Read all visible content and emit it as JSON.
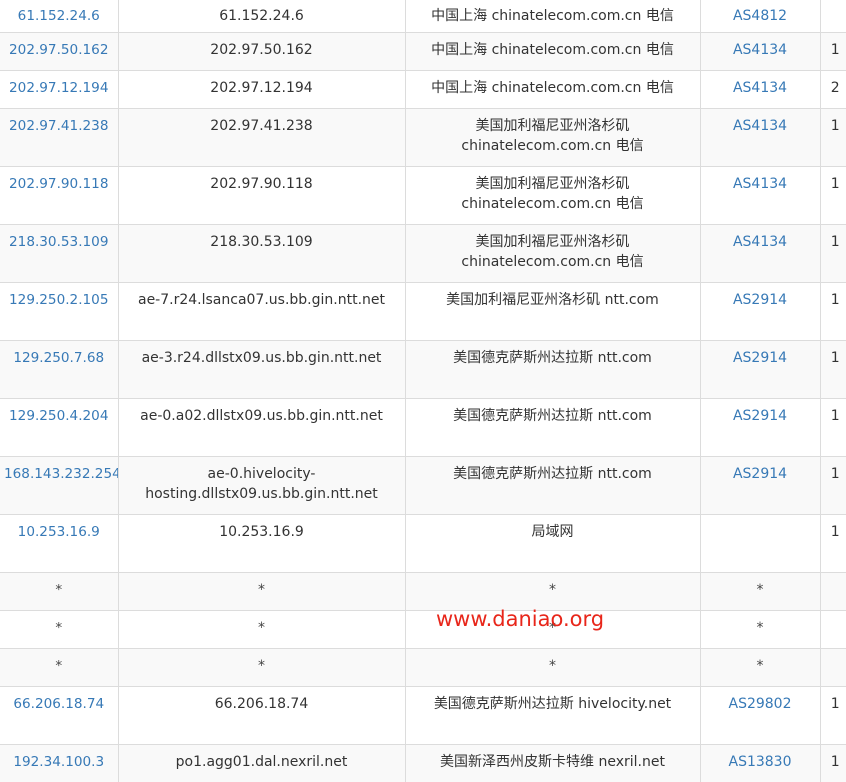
{
  "watermark": "www.daniao.org",
  "rows": [
    {
      "ip": "61.152.24.6",
      "host": "61.152.24.6",
      "location": "中国上海 chinatelecom.com.cn 电信",
      "asn": "AS4812",
      "extra": ""
    },
    {
      "ip": "202.97.50.162",
      "host": "202.97.50.162",
      "location": "中国上海 chinatelecom.com.cn 电信",
      "asn": "AS4134",
      "extra": "1"
    },
    {
      "ip": "202.97.12.194",
      "host": "202.97.12.194",
      "location": "中国上海 chinatelecom.com.cn 电信",
      "asn": "AS4134",
      "extra": "2"
    },
    {
      "ip": "202.97.41.238",
      "host": "202.97.41.238",
      "location": "美国加利福尼亚州洛杉矶 chinatelecom.com.cn 电信",
      "asn": "AS4134",
      "extra": "1"
    },
    {
      "ip": "202.97.90.118",
      "host": "202.97.90.118",
      "location": "美国加利福尼亚州洛杉矶 chinatelecom.com.cn 电信",
      "asn": "AS4134",
      "extra": "1"
    },
    {
      "ip": "218.30.53.109",
      "host": "218.30.53.109",
      "location": "美国加利福尼亚州洛杉矶 chinatelecom.com.cn 电信",
      "asn": "AS4134",
      "extra": "1"
    },
    {
      "ip": "129.250.2.105",
      "host": "ae-7.r24.lsanca07.us.bb.gin.ntt.net",
      "location": "美国加利福尼亚州洛杉矶 ntt.com",
      "asn": "AS2914",
      "extra": "1"
    },
    {
      "ip": "129.250.7.68",
      "host": "ae-3.r24.dllstx09.us.bb.gin.ntt.net",
      "location": "美国德克萨斯州达拉斯 ntt.com",
      "asn": "AS2914",
      "extra": "1"
    },
    {
      "ip": "129.250.4.204",
      "host": "ae-0.a02.dllstx09.us.bb.gin.ntt.net",
      "location": "美国德克萨斯州达拉斯 ntt.com",
      "asn": "AS2914",
      "extra": "1"
    },
    {
      "ip": "168.143.232.254",
      "host": "ae-0.hivelocity-hosting.dllstx09.us.bb.gin.ntt.net",
      "location": "美国德克萨斯州达拉斯 ntt.com",
      "asn": "AS2914",
      "extra": "1"
    },
    {
      "ip": "10.253.16.9",
      "host": "10.253.16.9",
      "location": "局域网",
      "asn": "",
      "extra": "1"
    },
    {
      "ip": "*",
      "host": "*",
      "location": "*",
      "asn": "*",
      "extra": ""
    },
    {
      "ip": "*",
      "host": "*",
      "location": "*",
      "asn": "*",
      "extra": ""
    },
    {
      "ip": "*",
      "host": "*",
      "location": "*",
      "asn": "*",
      "extra": ""
    },
    {
      "ip": "66.206.18.74",
      "host": "66.206.18.74",
      "location": "美国德克萨斯州达拉斯 hivelocity.net",
      "asn": "AS29802",
      "extra": "1"
    },
    {
      "ip": "192.34.100.3",
      "host": "po1.agg01.dal.nexril.net",
      "location": "美国新泽西州皮斯卡特维 nexril.net",
      "asn": "AS13830",
      "extra": "1"
    }
  ]
}
